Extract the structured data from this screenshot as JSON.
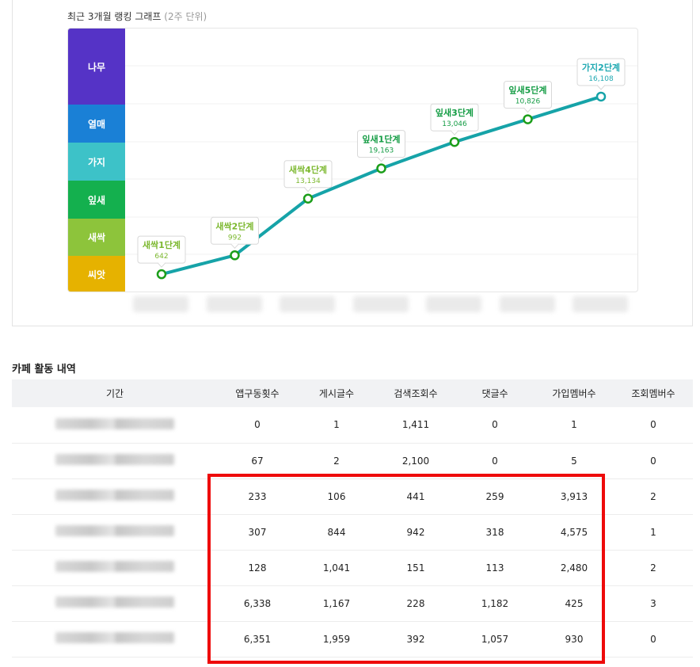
{
  "ranking": {
    "title": "최근 3개월 랭킹 그래프",
    "unit": "(2주 단위)",
    "levels": [
      {
        "name": "나무",
        "color": "#5533c6"
      },
      {
        "name": "열매",
        "color": "#1a80d6"
      },
      {
        "name": "가지",
        "color": "#3dc2c8"
      },
      {
        "name": "잎새",
        "color": "#14b04e"
      },
      {
        "name": "새싹",
        "color": "#8dc43b"
      },
      {
        "name": "씨앗",
        "color": "#e6b200"
      }
    ],
    "line_color": "#16a3a8",
    "point_color": "#1c9e1a"
  },
  "chart_data": {
    "type": "line",
    "title": "최근 3개월 랭킹 그래프",
    "series": [
      {
        "points": [
          {
            "label": "새싹1단계",
            "value": "642",
            "label_color": "#7cb82f"
          },
          {
            "label": "새싹2단계",
            "value": "992",
            "label_color": "#7cb82f"
          },
          {
            "label": "새싹4단계",
            "value": "13,134",
            "label_color": "#7cb82f"
          },
          {
            "label": "잎새1단계",
            "value": "19,163",
            "label_color": "#149c44"
          },
          {
            "label": "잎새3단계",
            "value": "13,046",
            "label_color": "#149c44"
          },
          {
            "label": "잎새5단계",
            "value": "10,826",
            "label_color": "#149c44"
          },
          {
            "label": "가지2단계",
            "value": "16,108",
            "label_color": "#1fa9b2"
          }
        ]
      }
    ],
    "level_position": [
      0.5,
      1.0,
      2.5,
      3.3,
      4.0,
      4.6,
      5.2
    ],
    "level_range": [
      0,
      7
    ]
  },
  "activity": {
    "title": "카페 활동 내역",
    "columns": [
      "기간",
      "앱구동횟수",
      "게시글수",
      "검색조회수",
      "댓글수",
      "가입멤버수",
      "조회멤버수"
    ],
    "rows": [
      [
        "0",
        "1",
        "1,411",
        "0",
        "1",
        "0"
      ],
      [
        "67",
        "2",
        "2,100",
        "0",
        "5",
        "0"
      ],
      [
        "233",
        "106",
        "441",
        "259",
        "3,913",
        "2"
      ],
      [
        "307",
        "844",
        "942",
        "318",
        "4,575",
        "1"
      ],
      [
        "128",
        "1,041",
        "151",
        "113",
        "2,480",
        "2"
      ],
      [
        "6,338",
        "1,167",
        "228",
        "1,182",
        "425",
        "3"
      ],
      [
        "6,351",
        "1,959",
        "392",
        "1,057",
        "930",
        "0"
      ]
    ],
    "highlight_color": "#ee0a0a"
  }
}
